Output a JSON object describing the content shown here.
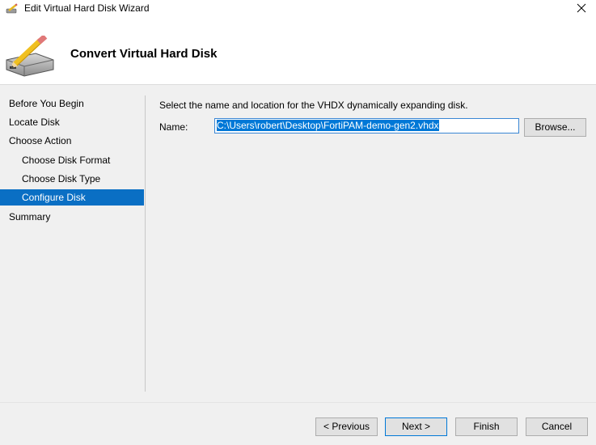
{
  "window": {
    "title": "Edit Virtual Hard Disk Wizard",
    "icon": "disk-pencil-icon",
    "close_glyph": "✕"
  },
  "header": {
    "title": "Convert Virtual Hard Disk",
    "icon": "disk-pencil-icon"
  },
  "nav": {
    "items": [
      {
        "label": "Before You Begin",
        "active": false,
        "indent": false
      },
      {
        "label": "Locate Disk",
        "active": false,
        "indent": false
      },
      {
        "label": "Choose Action",
        "active": false,
        "indent": false
      },
      {
        "label": "Choose Disk Format",
        "active": false,
        "indent": true
      },
      {
        "label": "Choose Disk Type",
        "active": false,
        "indent": true
      },
      {
        "label": "Configure Disk",
        "active": true,
        "indent": true
      },
      {
        "label": "Summary",
        "active": false,
        "indent": false
      }
    ]
  },
  "main": {
    "instruction": "Select the name and location for the VHDX dynamically expanding disk.",
    "name_label": "Name:",
    "name_value": "C:\\Users\\robert\\Desktop\\FortiPAM-demo-gen2.vhdx",
    "browse_label": "Browse..."
  },
  "footer": {
    "previous_label": "< Previous",
    "next_label": "Next >",
    "finish_label": "Finish",
    "cancel_label": "Cancel"
  },
  "colors": {
    "active_nav": "#0a6fc4",
    "selection": "#0078d7",
    "panel_bg": "#f0f0f0"
  }
}
